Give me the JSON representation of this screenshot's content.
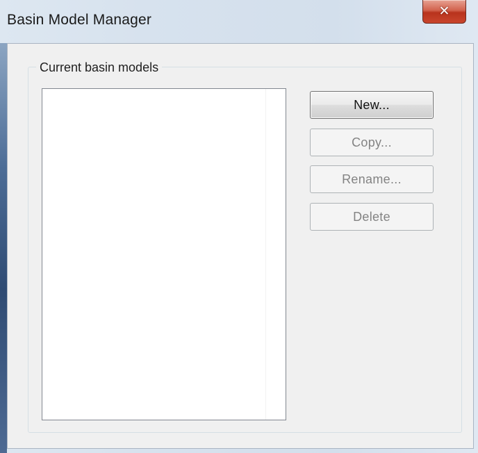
{
  "window": {
    "title": "Basin Model Manager",
    "close_glyph": "✕"
  },
  "group": {
    "label": "Current basin models"
  },
  "basin_models": [],
  "buttons": {
    "new": "New...",
    "copy": "Copy...",
    "rename": "Rename...",
    "delete": "Delete"
  },
  "button_states": {
    "new": "enabled",
    "copy": "disabled",
    "rename": "disabled",
    "delete": "disabled"
  },
  "icons": {
    "close": "close-icon"
  },
  "colors": {
    "close_button": "#c9452c",
    "dialog_background": "#f0f0f0",
    "disabled_text": "#838383"
  }
}
